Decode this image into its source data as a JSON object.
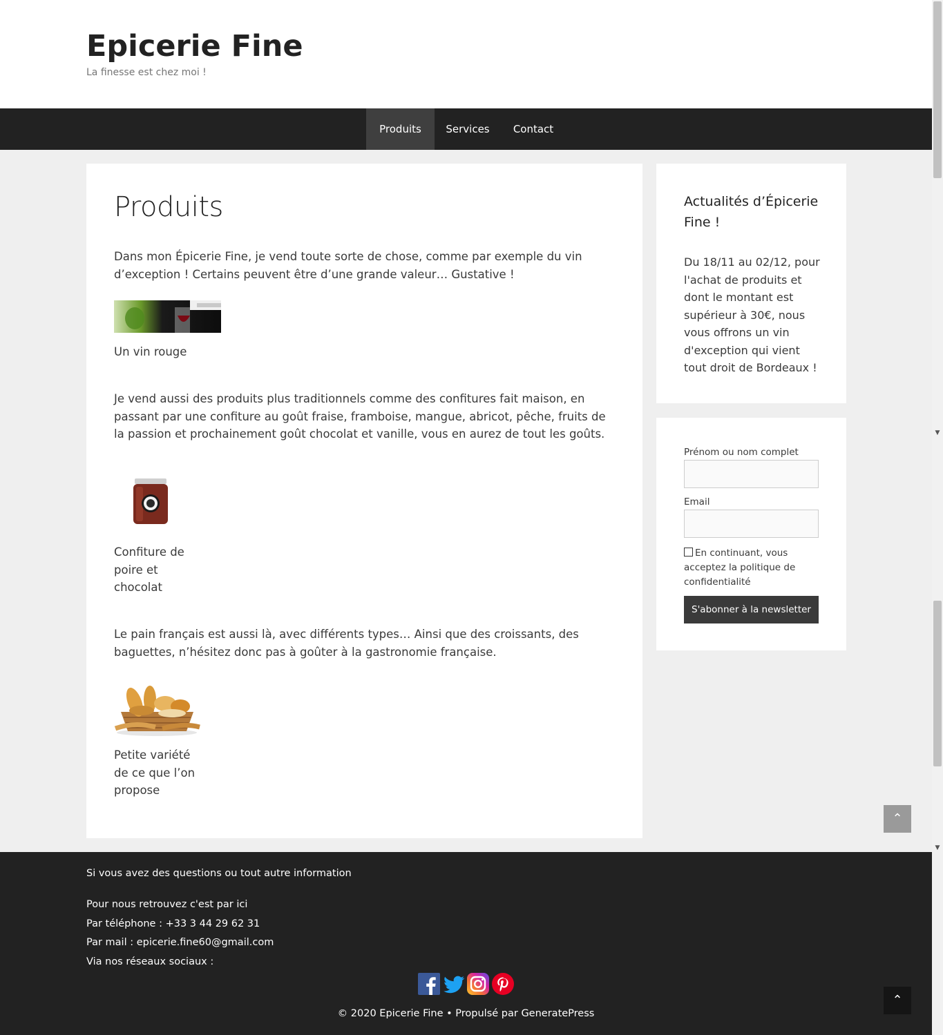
{
  "header": {
    "title": "Epicerie Fine",
    "tagline": "La finesse est chez moi !"
  },
  "nav": {
    "items": [
      {
        "label": "Produits",
        "active": true
      },
      {
        "label": "Services"
      },
      {
        "label": "Contact"
      }
    ]
  },
  "main": {
    "title": "Produits",
    "intro": "Dans mon Épicerie Fine, je vend toute sorte de chose, comme par exemple du vin d’exception ! Certains peuvent être d’une grande valeur… Gustative !",
    "wine_caption": "Un vin rouge",
    "traditional_text": "Je vend aussi des produits plus traditionnels comme des confitures fait maison, en passant par une confiture au goût fraise, framboise, mangue, abricot, pêche, fruits de la passion et prochainement goût chocolat et vanille, vous en aurez de tout les goûts.",
    "jam_caption": "Confiture de poire et chocolat",
    "bread_text": "Le pain français est aussi là, avec différents types… Ainsi que des croissants, des baguettes, n’hésitez donc pas à goûter à la gastronomie française.",
    "bread_caption": "Petite variété de ce que l’on propose"
  },
  "sidebar": {
    "news_title": "Actualités d’Épicerie Fine !",
    "news_text": "Du 18/11 au 02/12, pour l'achat de produits et dont le montant est supérieur à 30€, nous vous offrons un vin d'exception qui vient tout droit de Bordeaux !",
    "form": {
      "name_label": "Prénom ou nom complet",
      "email_label": "Email",
      "consent_text": "En continuant, vous acceptez la politique de confidentialité",
      "submit_label": "S'abonner à la newsletter"
    }
  },
  "footer": {
    "question": "Si vous avez des questions ou tout autre information",
    "find_us": "Pour nous retrouvez c'est par ici",
    "phone": "Par téléphone : +33 3 44 29 62 31",
    "mail": "Par mail : epicerie.fine60@gmail.com",
    "social": "Via nos réseaux sociaux :",
    "copyright": "© 2020 Epicerie Fine • Propulsé par GeneratePress",
    "social_icons": [
      "facebook-icon",
      "twitter-icon",
      "instagram-icon",
      "pinterest-icon"
    ]
  },
  "colors": {
    "nav_bg": "#222222",
    "nav_active": "#3f3f3f",
    "page_bg": "#efefef",
    "button": "#3a3a3a"
  }
}
